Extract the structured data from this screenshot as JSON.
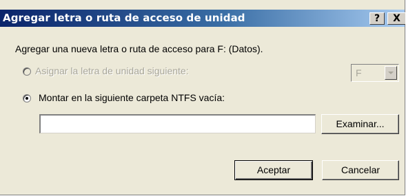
{
  "dialog": {
    "title": "Agregar letra o ruta de acceso de unidad",
    "help_label": "?",
    "close_label": "X",
    "description": "Agregar una nueva letra o ruta de acceso para F: (Datos).",
    "option_letter": {
      "label": "Asignar la letra de unidad siguiente:",
      "selected": false,
      "enabled": false
    },
    "drive_letter_select": {
      "value": "F",
      "enabled": false
    },
    "option_folder": {
      "label": "Montar en la siguiente carpeta NTFS vacía:",
      "selected": true,
      "enabled": true
    },
    "folder_path": {
      "value": ""
    },
    "browse_label": "Examinar...",
    "ok_label": "Aceptar",
    "cancel_label": "Cancelar"
  }
}
